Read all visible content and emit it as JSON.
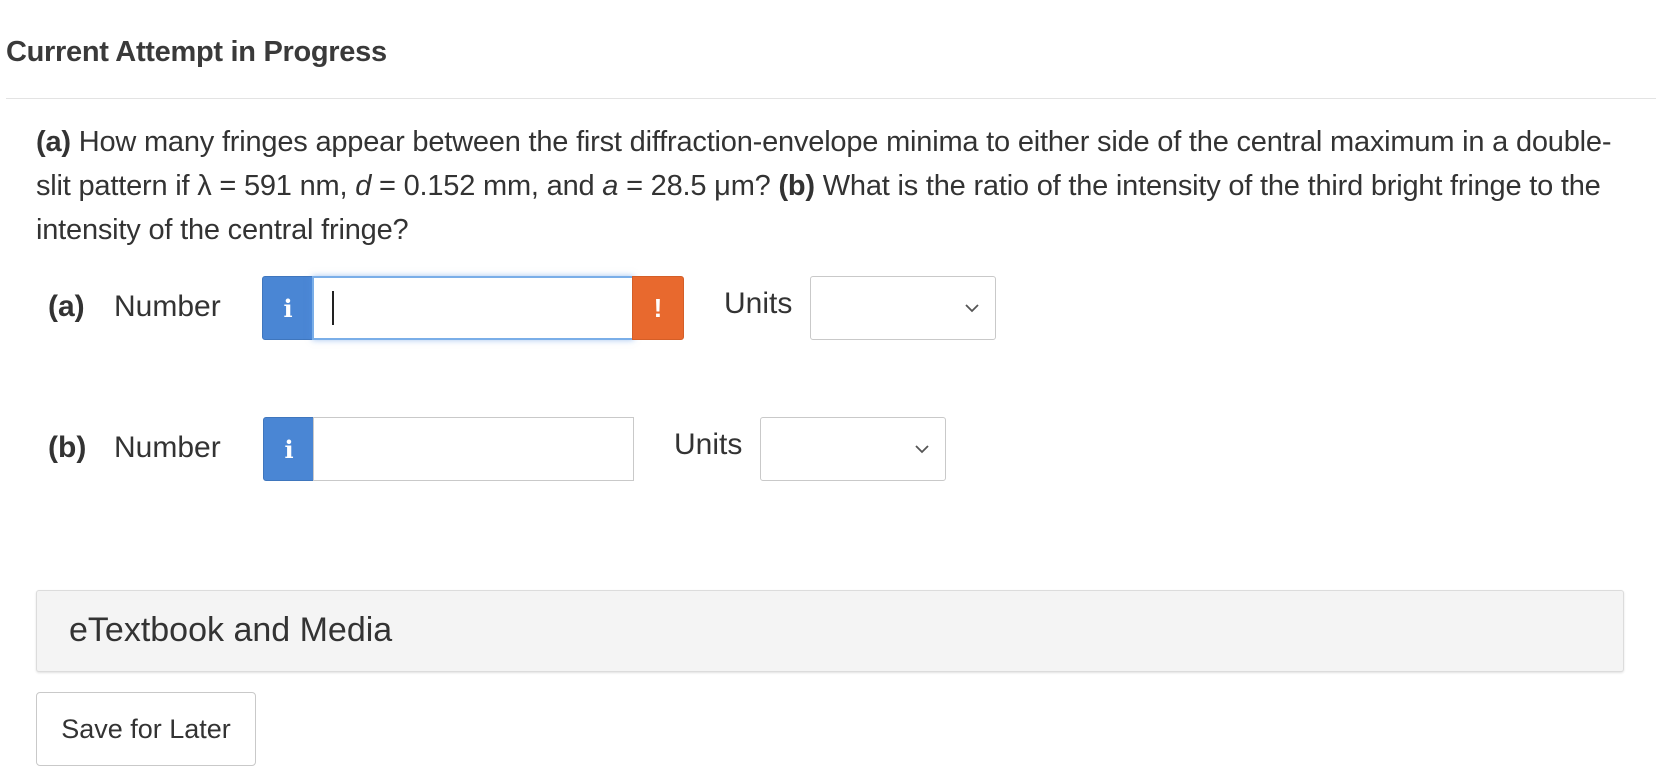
{
  "header": {
    "title": "Current Attempt in Progress"
  },
  "question": {
    "a_tag": "(a)",
    "part1": " How many fringes appear between the first diffraction-envelope minima to either side of the central maximum in a double-slit pattern if λ = 591 nm, ",
    "d_var": "d",
    "part2": " = 0.152 mm, and ",
    "a_var": "a",
    "part3": " = 28.5 μm? ",
    "b_tag": "(b)",
    "part4": " What is the ratio of the intensity of the third bright fringe to the intensity of the central fringe?"
  },
  "part_a": {
    "label": "(a)",
    "number_label": "Number",
    "info_icon": "i",
    "value": "",
    "warning_icon": "!",
    "units_label": "Units",
    "units_selected": ""
  },
  "part_b": {
    "label": "(b)",
    "number_label": "Number",
    "info_icon": "i",
    "value": "",
    "units_label": "Units",
    "units_selected": ""
  },
  "etextbook": {
    "title": "eTextbook and Media"
  },
  "actions": {
    "save_label": "Save for Later"
  },
  "colors": {
    "info_blue": "#4a86d4",
    "warning_orange": "#e8692e",
    "focus_blue": "#7aaee8"
  }
}
